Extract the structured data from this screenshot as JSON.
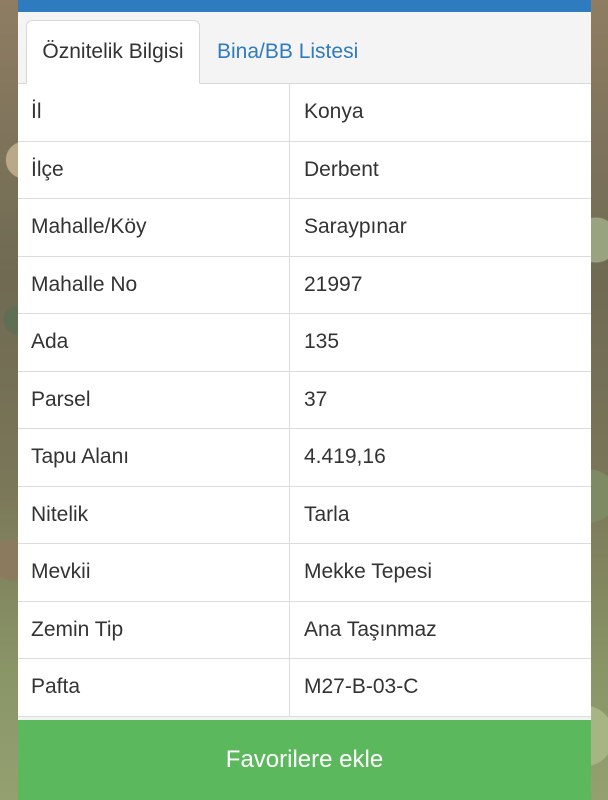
{
  "tabs": [
    {
      "label": "Öznitelik Bilgisi",
      "active": true
    },
    {
      "label": "Bina/BB Listesi",
      "active": false
    }
  ],
  "attributes": [
    {
      "key": "İl",
      "value": "Konya"
    },
    {
      "key": "İlçe",
      "value": "Derbent"
    },
    {
      "key": "Mahalle/Köy",
      "value": "Saraypınar"
    },
    {
      "key": "Mahalle No",
      "value": "21997"
    },
    {
      "key": "Ada",
      "value": "135"
    },
    {
      "key": "Parsel",
      "value": "37"
    },
    {
      "key": "Tapu Alanı",
      "value": "4.419,16"
    },
    {
      "key": "Nitelik",
      "value": "Tarla"
    },
    {
      "key": "Mevkii",
      "value": "Mekke Tepesi"
    },
    {
      "key": "Zemin Tip",
      "value": "Ana Taşınmaz"
    },
    {
      "key": "Pafta",
      "value": "M27-B-03-C"
    }
  ],
  "actions": {
    "favorite_label": "Favorilere ekle"
  },
  "colors": {
    "tab_link": "#2f7bbf",
    "top_bar": "#2f7bbf",
    "favorite_button": "#5cb85c"
  }
}
